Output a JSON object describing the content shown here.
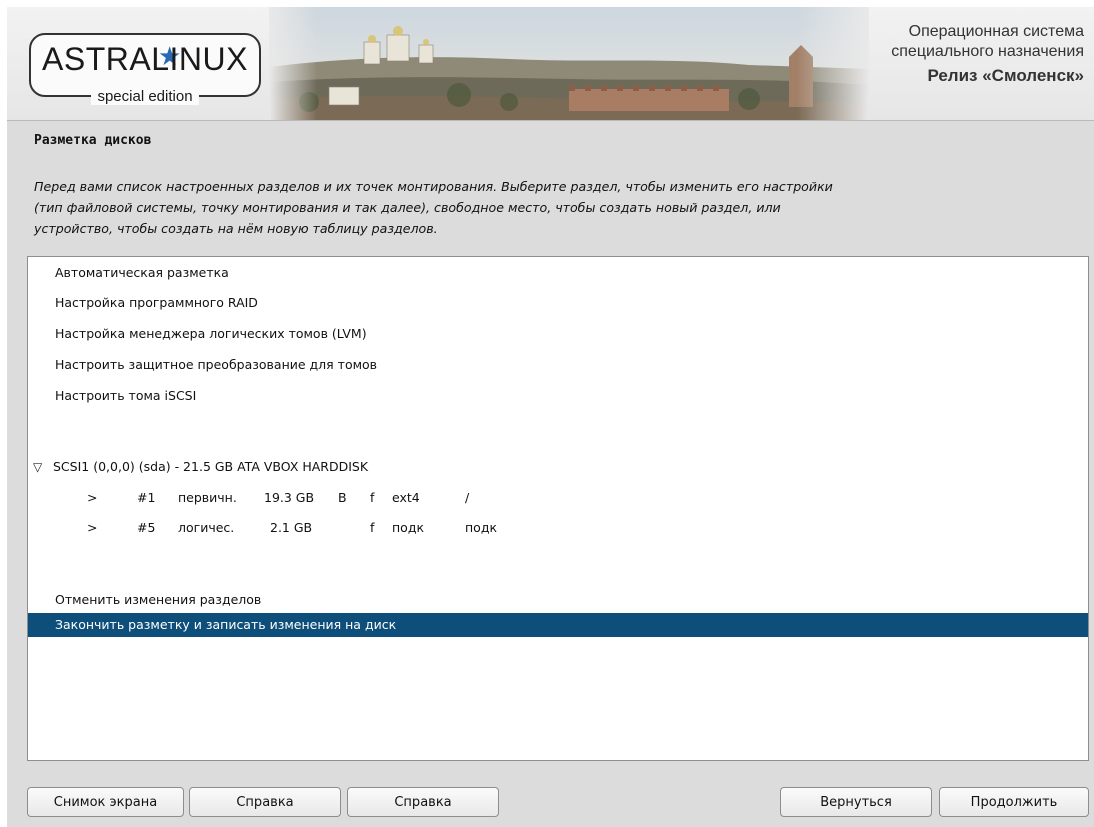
{
  "header": {
    "logo_text": "ASTRALINUX",
    "logo_sub": "special edition",
    "brand_line1": "Операционная система",
    "brand_line2": "специального назначения",
    "brand_line3": "Релиз «Смоленск»"
  },
  "page": {
    "title": "Разметка дисков",
    "description": "Перед вами список настроенных разделов и их точек монтирования. Выберите раздел, чтобы изменить его настройки\n(тип файловой системы, точку монтирования и так далее), свободное место, чтобы создать новый раздел, или\nустройство, чтобы создать на нём новую таблицу разделов."
  },
  "list": {
    "menu_items": [
      "Автоматическая разметка",
      "Настройка программного RAID",
      "Настройка менеджера логических томов (LVM)",
      "Настроить защитное преобразование для томов",
      "Настроить тома iSCSI"
    ],
    "disk": {
      "expander": "▽",
      "label": "SCSI1 (0,0,0) (sda) - 21.5 GB ATA VBOX HARDDISK"
    },
    "partitions": [
      {
        "arrow": ">",
        "num": "#1",
        "type": "первичн.",
        "size": "19.3 GB",
        "boot": "B",
        "fmt": "f",
        "fs": "ext4",
        "mount": "/"
      },
      {
        "arrow": ">",
        "num": "#5",
        "type": "логичес.",
        "size": "2.1 GB",
        "boot": "",
        "fmt": "f",
        "fs": "подк",
        "mount": "подк"
      }
    ],
    "undo_label": "Отменить изменения разделов",
    "finish_label": "Закончить разметку и записать изменения на диск"
  },
  "buttons": {
    "screenshot": "Снимок экрана",
    "help1": "Справка",
    "help2": "Справка",
    "back": "Вернуться",
    "continue": "Продолжить"
  },
  "colors": {
    "selection": "#0d4f7a",
    "logo_star": "#2a6ab4"
  }
}
